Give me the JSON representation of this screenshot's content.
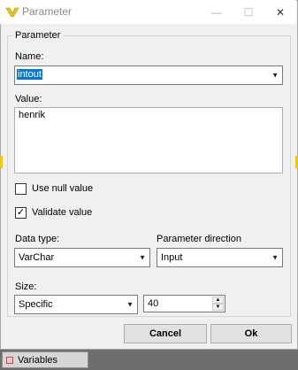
{
  "dialog": {
    "title": "Parameter",
    "minimize": "—",
    "maximize": "☐",
    "close": "✕"
  },
  "group": {
    "label": "Parameter"
  },
  "name": {
    "label": "Name:",
    "value": "intout"
  },
  "value": {
    "label": "Value:",
    "text": "henrik"
  },
  "use_null": {
    "label": "Use null value",
    "checked": false
  },
  "validate": {
    "label": "Validate value",
    "checked": true,
    "mark": "✓"
  },
  "data_type": {
    "label": "Data type:",
    "selected": "VarChar"
  },
  "direction": {
    "label": "Parameter direction",
    "selected": "Input"
  },
  "size": {
    "label": "Size:",
    "selected": "Specific",
    "amount": "40"
  },
  "buttons": {
    "cancel": "Cancel",
    "ok": "Ok"
  },
  "background": {
    "tab_label": "Variables"
  },
  "colors": {
    "accent": "#0078d7",
    "icon_yellow": "#f0c800"
  }
}
